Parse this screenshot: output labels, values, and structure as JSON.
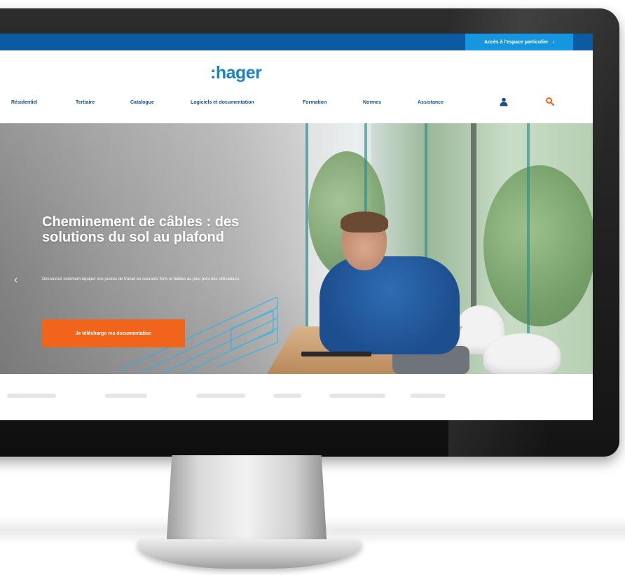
{
  "topbar": {
    "access_label": "Accès à l'espace particulier",
    "arrow": "›"
  },
  "logo": {
    "text": ":hager"
  },
  "nav": {
    "items": [
      {
        "label": "Résidentiel"
      },
      {
        "label": "Tertiaire"
      },
      {
        "label": "Catalogue"
      },
      {
        "label": "Logiciels et documentation"
      },
      {
        "label": "Formation"
      },
      {
        "label": "Normes"
      },
      {
        "label": "Assistance"
      }
    ],
    "user_icon": "user-icon",
    "search_icon": "search-icon"
  },
  "hero": {
    "title": "Cheminement de câbles : des solutions du sol au plafond",
    "text": "Découvrez comment équiper vos postes de travail en courants forts et faibles au plus près des utilisateurs.",
    "cta_label": "Je télécharge ma documentation",
    "prev_arrow": "‹"
  },
  "colors": {
    "topbar": "#0b5aa2",
    "topbar_button": "#1696df",
    "brand": "#1b82c8",
    "nav_text": "#1b4f86",
    "cta": "#f0641c",
    "search_icon": "#f0641c"
  }
}
